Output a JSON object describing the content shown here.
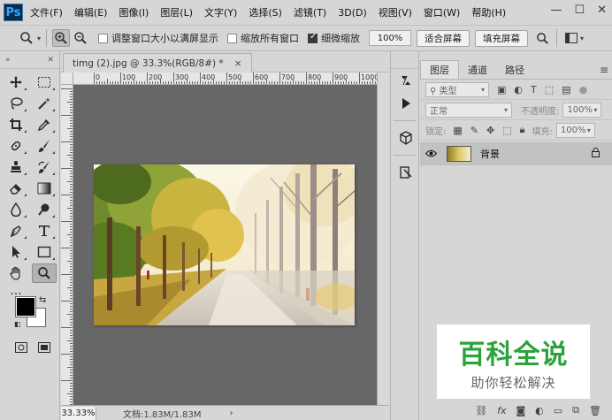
{
  "app": {
    "logo": "Ps"
  },
  "menu": [
    "文件(F)",
    "编辑(E)",
    "图像(I)",
    "图层(L)",
    "文字(Y)",
    "选择(S)",
    "滤镜(T)",
    "3D(D)",
    "视图(V)",
    "窗口(W)",
    "帮助(H)"
  ],
  "window_controls": {
    "minimize": "—",
    "maximize": "☐",
    "close": "✕"
  },
  "options": {
    "resize_windows_label": "调整窗口大小以满屏显示",
    "resize_windows_checked": false,
    "zoom_all_label": "缩放所有窗口",
    "zoom_all_checked": false,
    "scrubby_label": "细微缩放",
    "scrubby_checked": true,
    "zoom_value": "100%",
    "fit_screen": "适合屏幕",
    "fill_screen": "填充屏幕"
  },
  "document": {
    "tab_title": "timg (2).jpg @ 33.3%(RGB/8#) *",
    "close": "×",
    "ruler_labels": [
      "0",
      "100",
      "200",
      "300",
      "400",
      "500",
      "600",
      "700",
      "800",
      "900",
      "1000"
    ]
  },
  "status": {
    "zoom": "33.33%",
    "doc_info": "文档:1.83M/1.83M",
    "arrow": "›"
  },
  "layers_panel": {
    "tabs": [
      "图层",
      "通道",
      "路径"
    ],
    "active_tab": 0,
    "filter_kind": "类型",
    "blend_mode": "正常",
    "opacity_label": "不透明度:",
    "opacity_value": "100%",
    "lock_label": "锁定:",
    "fill_label": "填充:",
    "fill_value": "100%",
    "layers": [
      {
        "name": "背景",
        "visible": true,
        "locked": true
      }
    ],
    "bottom_icons": [
      "link-icon",
      "fx-icon",
      "mask-icon",
      "adjustment-icon",
      "folder-icon",
      "new-layer-icon",
      "trash-icon"
    ]
  },
  "watermark": {
    "title": "百科全说",
    "subtitle": "助你轻松解决"
  }
}
